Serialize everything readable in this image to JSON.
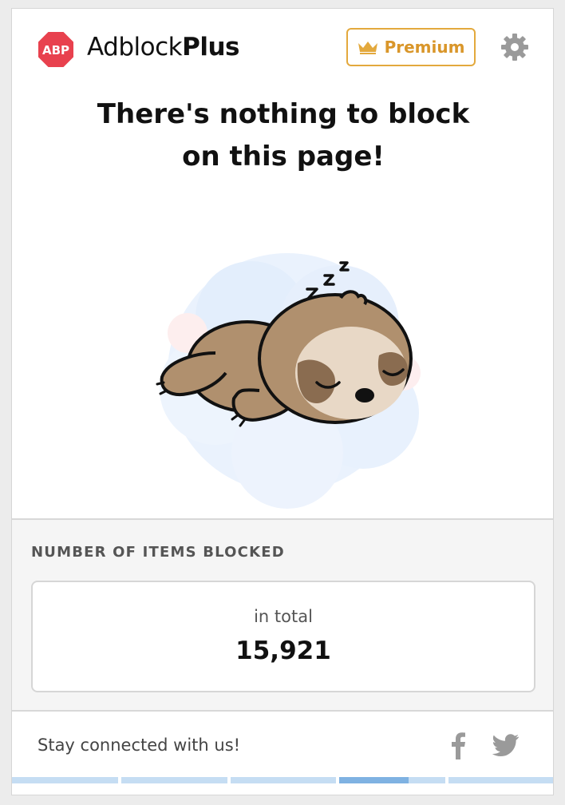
{
  "header": {
    "logo_text": "ABP",
    "brand_regular": "Adblock",
    "brand_bold": "Plus",
    "premium_label": "Premium"
  },
  "main": {
    "headline_line1": "There's nothing to block",
    "headline_line2": "on this page!",
    "illustration_text": "Z Z Z"
  },
  "stats": {
    "title": "NUMBER OF ITEMS BLOCKED",
    "total_label": "in total",
    "total_value": "15,921"
  },
  "footer": {
    "stay_text": "Stay connected with us!",
    "social": [
      "facebook-icon",
      "twitter-icon"
    ],
    "carousel_pages": 5,
    "carousel_active_page": 4,
    "carousel_active_progress": 0.65
  },
  "colors": {
    "abp_red": "#e8414e",
    "premium_gold": "#e3a93d",
    "gear_gray": "#9a9a9a",
    "progress_light": "#c5ddf3",
    "progress_dark": "#7fb2e2"
  }
}
